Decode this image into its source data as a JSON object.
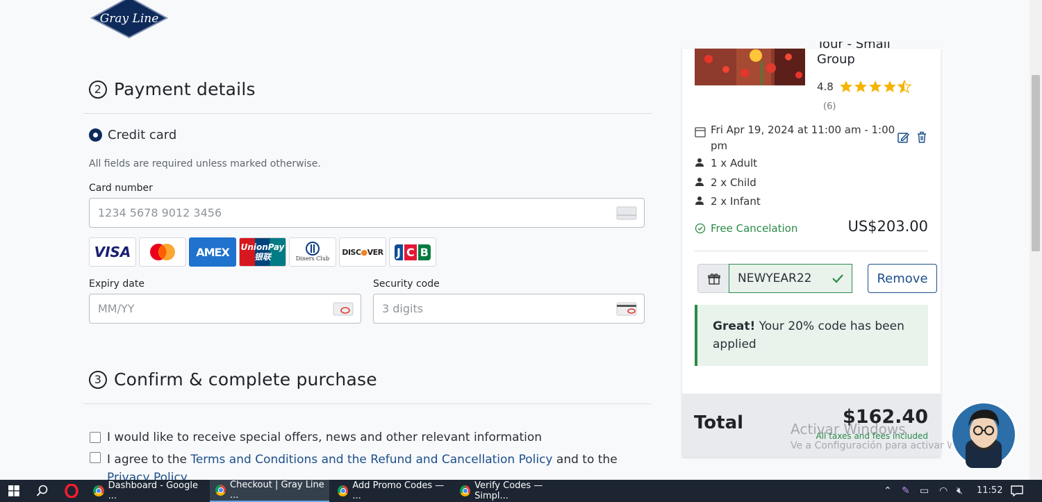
{
  "brand": {
    "logo_text": "Gray Line"
  },
  "payment": {
    "step_number": "2",
    "heading": "Payment details",
    "method_label": "Credit card",
    "required_note": "All fields are required unless marked otherwise.",
    "card_number_label": "Card number",
    "card_number_placeholder": "1234 5678 9012 3456",
    "expiry_label": "Expiry date",
    "expiry_placeholder": "MM/YY",
    "security_label": "Security code",
    "security_placeholder": "3 digits",
    "card_brands": [
      "VISA",
      "Mastercard",
      "AMEX",
      "UnionPay",
      "Diners Club",
      "DISCOVER",
      "JCB"
    ]
  },
  "confirm": {
    "step_number": "3",
    "heading": "Confirm & complete purchase",
    "offers_text": "I would like to receive special offers, news and other relevant information",
    "agree_prefix": "I agree to the ",
    "agree_link": "Terms and Conditions and the Refund and Cancellation Policy",
    "agree_suffix": " and to the",
    "privacy_link": "Privacy Policy"
  },
  "summary": {
    "tour_title_partial": "Tour - Small",
    "tour_title_line2": "Group",
    "rating": "4.8",
    "stars": 4.5,
    "review_count": "(6)",
    "date_line1": "Fri Apr 19, 2024 at 11:00 am - 1:00",
    "date_line2": "pm",
    "tickets": [
      "1 x Adult",
      "2 x Child",
      "2 x Infant"
    ],
    "free_cancel": "Free Cancelation",
    "subtotal": "US$203.00",
    "promo_code": "NEWYEAR22",
    "remove_label": "Remove",
    "success_bold": "Great!",
    "success_text": " Your 20% code has been applied",
    "total_label": "Total",
    "total_amount": "$162.40",
    "taxes_note": "All taxes and fees included"
  },
  "watermark": {
    "line1": "Activar Windows",
    "line2": "Ve a Configuración para activar Windows."
  },
  "taskbar": {
    "items": [
      "Dashboard - Google ...",
      "Checkout | Gray Line ...",
      "Add Promo Codes — ...",
      "Verify Codes — Simpl..."
    ],
    "time": "11:52"
  },
  "colors": {
    "navy": "#0e2a5a",
    "green": "#2a8a46",
    "star": "#f5b301",
    "link": "#1c4f8a"
  }
}
